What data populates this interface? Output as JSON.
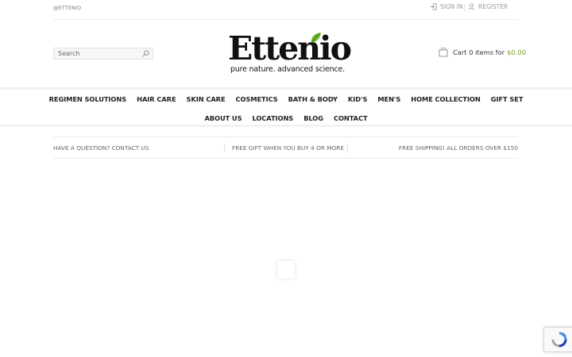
{
  "top_bar": {
    "handle": "@ETTENIO",
    "sign_in": "SIGN IN",
    "register": "REGISTER"
  },
  "search": {
    "placeholder": "Search",
    "icon": "search-icon"
  },
  "logo": {
    "wordmark": "Ettenio",
    "tagline": "pure nature. advanced science."
  },
  "cart": {
    "label": "Cart",
    "count_text": "0 items for",
    "total": "$0.00",
    "icon": "shopping-bag-icon"
  },
  "nav": {
    "row1": [
      "REGIMEN SOLUTIONS",
      "HAIR CARE",
      "SKIN CARE",
      "COSMETICS",
      "BATH & BODY",
      "KID'S",
      "MEN'S",
      "HOME COLLECTION",
      "GIFT SET"
    ],
    "row2": [
      "ABOUT US",
      "LOCATIONS",
      "BLOG",
      "CONTACT"
    ]
  },
  "info_bar": {
    "left": "HAVE A QUESTION? CONTACT US",
    "middle": "FREE GIFT WHEN YOU BUY 4 OR MORE",
    "right": "FREE SHIPPING! ALL ORDERS OVER $150"
  },
  "colors": {
    "accent_green": "#7aa228",
    "leaf_green": "#6ab42c",
    "text_dark": "#222222"
  }
}
